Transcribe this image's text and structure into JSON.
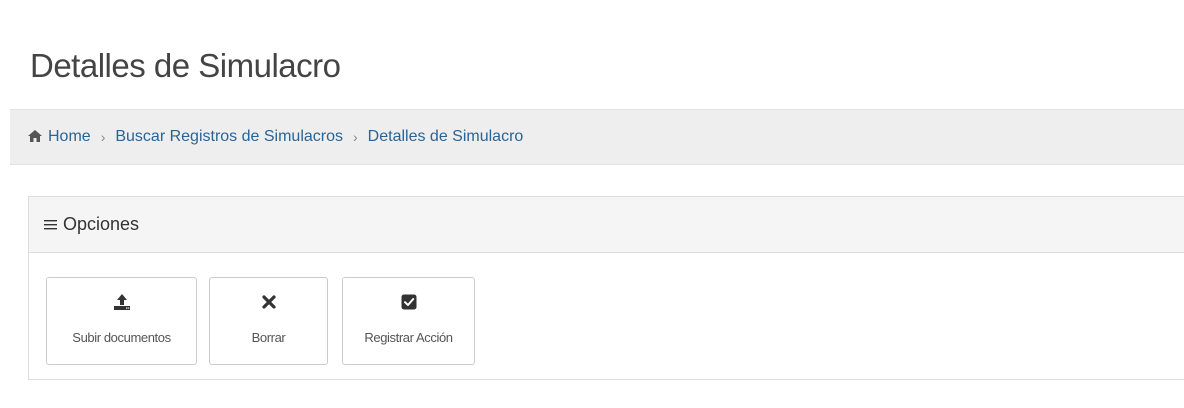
{
  "page": {
    "title": "Detalles de Simulacro"
  },
  "breadcrumb": {
    "items": [
      {
        "label": "Home",
        "icon": "home-icon"
      },
      {
        "label": "Buscar Registros de Simulacros"
      },
      {
        "label": "Detalles de Simulacro"
      }
    ],
    "separator": "›"
  },
  "options_panel": {
    "heading_icon": "bars-icon",
    "heading": "Opciones",
    "buttons": [
      {
        "label": "Subir documentos",
        "icon": "upload-icon"
      },
      {
        "label": "Borrar",
        "icon": "close-icon"
      },
      {
        "label": "Registrar Acción",
        "icon": "check-square-icon"
      }
    ]
  },
  "colors": {
    "link": "#2a6496",
    "breadcrumb_bg": "#eeeeee",
    "panel_heading_bg": "#f5f5f5",
    "title_text": "#444444"
  }
}
